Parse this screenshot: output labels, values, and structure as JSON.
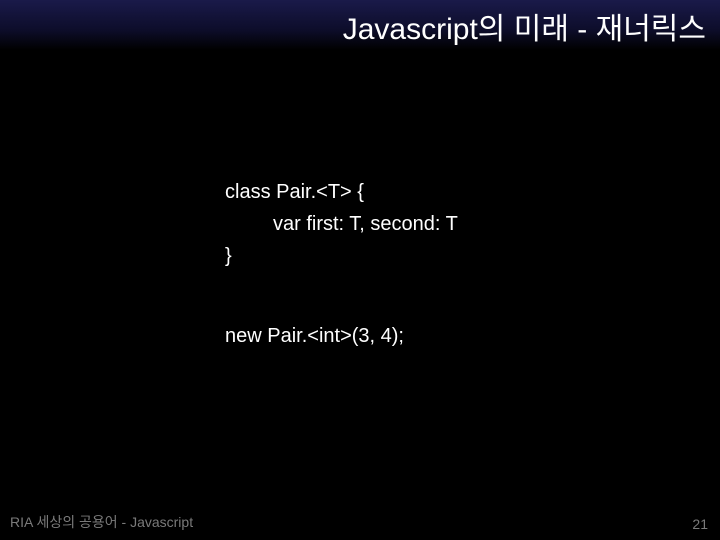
{
  "header": {
    "title": "Javascript의 미래 - 재너릭스"
  },
  "code": {
    "line1": "class Pair.<T> {",
    "line2": "var first: T, second: T",
    "line3": "}",
    "line4": "new Pair.<int>(3, 4);"
  },
  "footer": {
    "left": "RIA 세상의 공용어 - Javascript",
    "page": "21"
  }
}
